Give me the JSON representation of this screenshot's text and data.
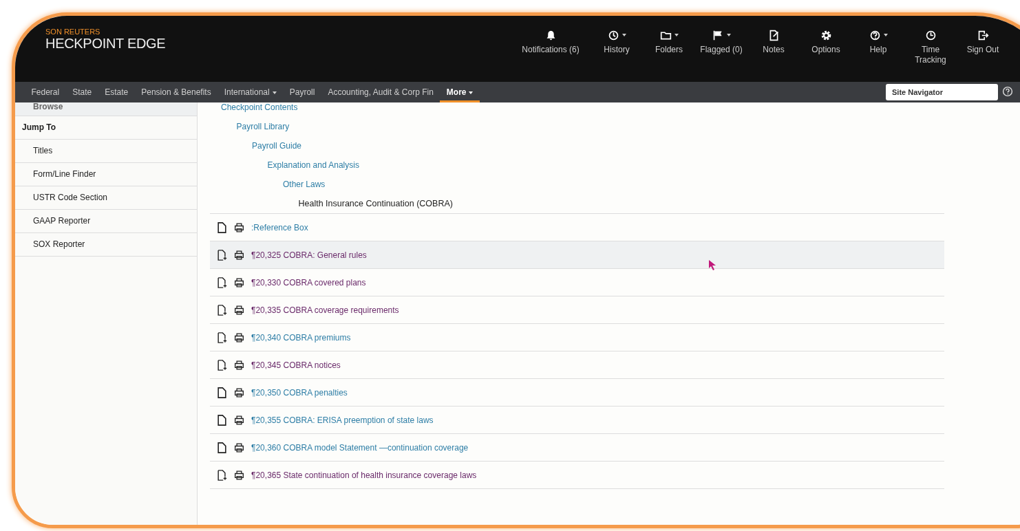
{
  "logo": {
    "brand": "SON REUTERS",
    "product": "HECKPOINT EDGE"
  },
  "header_actions": [
    {
      "label": "Notifications (6)",
      "menu": false
    },
    {
      "label": "History",
      "menu": true
    },
    {
      "label": "Folders",
      "menu": true
    },
    {
      "label": "Flagged (0)",
      "menu": true
    },
    {
      "label": "Notes",
      "menu": false
    },
    {
      "label": "Options",
      "menu": false
    },
    {
      "label": "Help",
      "menu": true
    },
    {
      "label": "Time Tracking",
      "menu": false
    },
    {
      "label": "Sign Out",
      "menu": false
    }
  ],
  "nav_tabs": [
    {
      "label": "Federal",
      "menu": false,
      "selected": false
    },
    {
      "label": "State",
      "menu": false,
      "selected": false
    },
    {
      "label": "Estate",
      "menu": false,
      "selected": false
    },
    {
      "label": "Pension & Benefits",
      "menu": false,
      "selected": false
    },
    {
      "label": "International",
      "menu": true,
      "selected": false
    },
    {
      "label": "Payroll",
      "menu": false,
      "selected": false
    },
    {
      "label": "Accounting, Audit & Corp Fin",
      "menu": false,
      "selected": false
    },
    {
      "label": "More",
      "menu": true,
      "selected": true
    }
  ],
  "search": {
    "placeholder": "Site Navigator"
  },
  "sidebar": {
    "items": [
      {
        "label": "Browse",
        "kind": "tab"
      },
      {
        "label": "Jump To",
        "kind": "heading"
      },
      {
        "label": "Titles",
        "kind": "link"
      },
      {
        "label": "Form/Line Finder",
        "kind": "link"
      },
      {
        "label": "USTR Code Section",
        "kind": "link"
      },
      {
        "label": "GAAP Reporter",
        "kind": "link"
      },
      {
        "label": "SOX Reporter",
        "kind": "link"
      }
    ]
  },
  "breadcrumb": {
    "label": "Checkpoint Contents",
    "current": false,
    "children": [
      {
        "label": "Payroll Library",
        "current": false,
        "children": [
          {
            "label": "Payroll Guide",
            "current": false,
            "children": [
              {
                "label": "Explanation and Analysis",
                "current": false,
                "children": [
                  {
                    "label": "Other Laws",
                    "current": false,
                    "children": [
                      {
                        "label": "Health Insurance Continuation (COBRA)",
                        "current": true
                      }
                    ]
                  }
                ]
              }
            ]
          }
        ]
      }
    ]
  },
  "documents": [
    {
      "title": ":Reference Box",
      "kind": "doc",
      "visited": false,
      "highlighted": false
    },
    {
      "title": "¶20,325 COBRA: General rules",
      "kind": "doc-add",
      "visited": true,
      "highlighted": true
    },
    {
      "title": "¶20,330 COBRA covered plans",
      "kind": "doc-add",
      "visited": true,
      "highlighted": false
    },
    {
      "title": "¶20,335 COBRA coverage requirements",
      "kind": "doc-add",
      "visited": true,
      "highlighted": false
    },
    {
      "title": "¶20,340 COBRA premiums",
      "kind": "doc-add",
      "visited": false,
      "highlighted": false
    },
    {
      "title": "¶20,345 COBRA notices",
      "kind": "doc-add",
      "visited": true,
      "highlighted": false
    },
    {
      "title": "¶20,350 COBRA penalties",
      "kind": "doc",
      "visited": false,
      "highlighted": false
    },
    {
      "title": "¶20,355 COBRA: ERISA preemption of state laws",
      "kind": "doc",
      "visited": false,
      "highlighted": false
    },
    {
      "title": "¶20,360 COBRA model Statement —continuation coverage",
      "kind": "doc",
      "visited": false,
      "highlighted": false
    },
    {
      "title": "¶20,365 State continuation of health insurance coverage laws",
      "kind": "doc-add",
      "visited": true,
      "highlighted": false
    }
  ]
}
